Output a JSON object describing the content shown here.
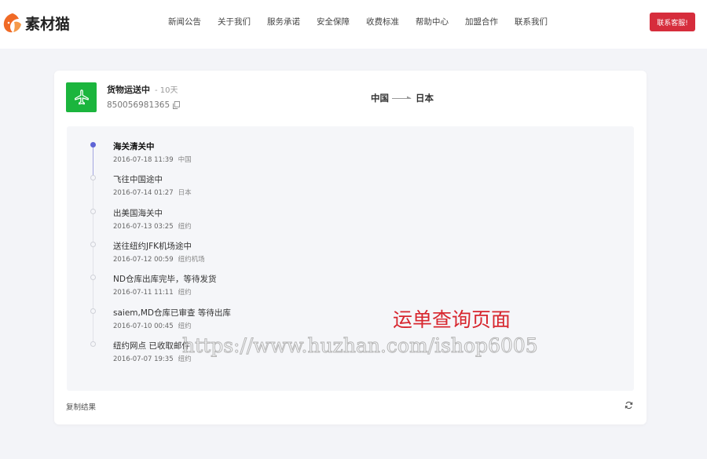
{
  "brand": {
    "name": "素材猫",
    "accent": "#f06a26"
  },
  "nav": {
    "items": [
      "新闻公告",
      "关于我们",
      "服务承诺",
      "安全保障",
      "收费标准",
      "帮助中心",
      "加盟合作",
      "联系我们"
    ]
  },
  "header": {
    "contact_label": "联系客服!",
    "contact_color": "#d62d3c"
  },
  "shipment": {
    "status": "货物运送中",
    "duration": "- 10天",
    "tracking_number": "850056981365",
    "status_color": "#1bb53d",
    "status_icon": "airplane-icon",
    "origin": "中国",
    "destination": "日本"
  },
  "timeline": [
    {
      "title": "海关清关中",
      "time": "2016-07-18 11:39",
      "location": "中国",
      "active": true
    },
    {
      "title": "飞往中国途中",
      "time": "2016-07-14 01:27",
      "location": "日本",
      "active": false
    },
    {
      "title": "出美国海关中",
      "time": "2016-07-13 03:25",
      "location": "纽约",
      "active": false
    },
    {
      "title": "送往纽约JFK机场途中",
      "time": "2016-07-12 00:59",
      "location": "纽约机场",
      "active": false
    },
    {
      "title": "ND仓库出库完毕，等待发货",
      "time": "2016-07-11 11:11",
      "location": "纽约",
      "active": false
    },
    {
      "title": "saiem,MD仓库已审查 等待出库",
      "time": "2016-07-10 00:45",
      "location": "纽约",
      "active": false
    },
    {
      "title": "纽约网点 已收取邮件",
      "time": "2016-07-07 19:35",
      "location": "纽约",
      "active": false
    }
  ],
  "footer": {
    "copy_label": "复制结果",
    "refresh_icon": "refresh-icon"
  },
  "watermark": {
    "title": "运单查询页面",
    "url": "https://www.huzhan.com/ishop6005"
  }
}
